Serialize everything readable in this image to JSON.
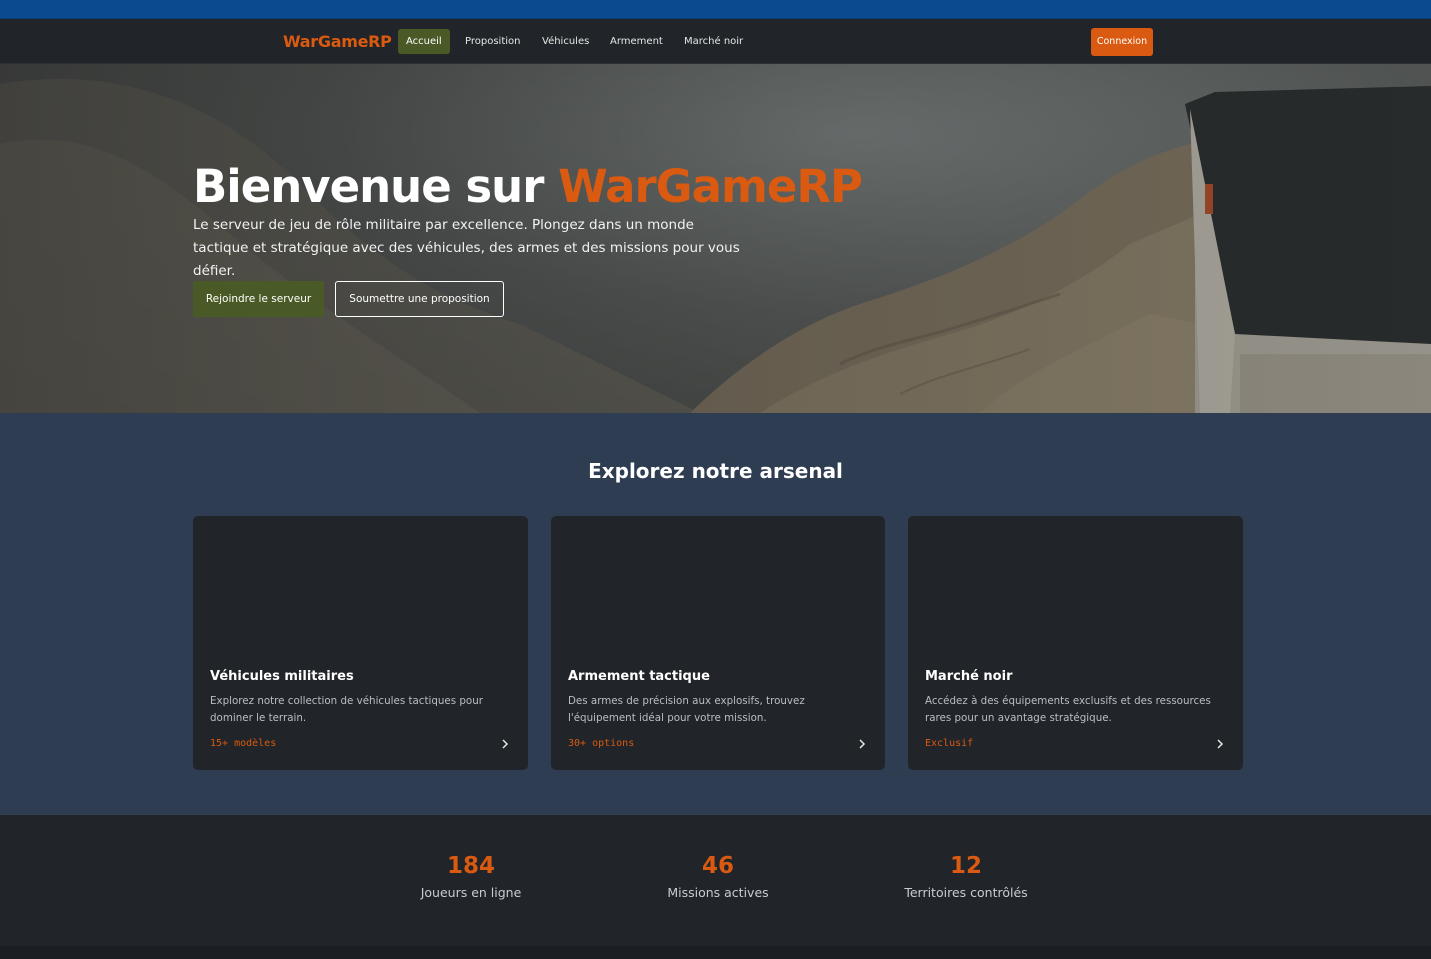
{
  "nav": {
    "brand": "WarGameRP",
    "items": [
      {
        "label": "Accueil",
        "active": true
      },
      {
        "label": "Proposition",
        "active": false
      },
      {
        "label": "Véhicules",
        "active": false
      },
      {
        "label": "Armement",
        "active": false
      },
      {
        "label": "Marché noir",
        "active": false
      }
    ],
    "login_label": "Connexion"
  },
  "hero": {
    "title_prefix": "Bienvenue sur",
    "title_accent": "WarGameRP",
    "subtitle": "Le serveur de jeu de rôle militaire par excellence. Plongez dans un monde tactique et stratégique avec des véhicules, des armes et des missions pour vous défier.",
    "join_label": "Rejoindre le serveur",
    "propose_label": "Soumettre une proposition"
  },
  "arsenal": {
    "title": "Explorez notre arsenal",
    "cards": [
      {
        "title": "Véhicules militaires",
        "description": "Explorez notre collection de véhicules tactiques pour dominer le terrain.",
        "tag": "15+ modèles"
      },
      {
        "title": "Armement tactique",
        "description": "Des armes de précision aux explosifs, trouvez l'équipement idéal pour votre mission.",
        "tag": "30+ options"
      },
      {
        "title": "Marché noir",
        "description": "Accédez à des équipements exclusifs et des ressources rares pour un avantage stratégique.",
        "tag": "Exclusif"
      }
    ]
  },
  "stats": [
    {
      "value": "184",
      "label": "Joueurs en ligne"
    },
    {
      "value": "46",
      "label": "Missions actives"
    },
    {
      "value": "12",
      "label": "Territoires contrôlés"
    }
  ],
  "colors": {
    "accent": "#d95a10",
    "olive": "#4a5a26",
    "navy_section": "#2e3d51",
    "dark": "#212529"
  }
}
